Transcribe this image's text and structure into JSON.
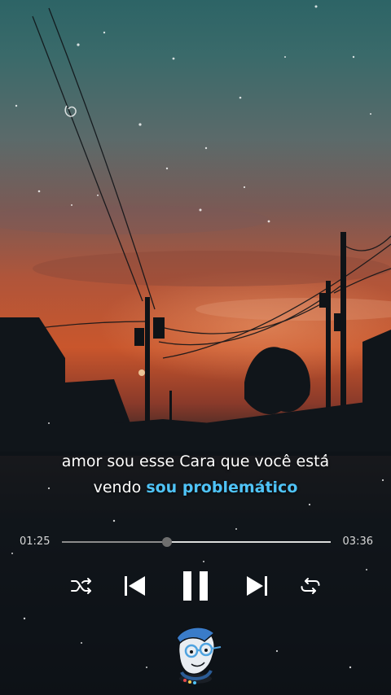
{
  "lyrics": {
    "line1": "amor sou esse Cara que você está",
    "line2_plain": "vendo ",
    "line2_highlight": "sou problemático"
  },
  "player": {
    "current_time": "01:25",
    "total_time": "03:36",
    "progress": 0.39
  },
  "controls": {
    "shuffle_icon": "shuffle-icon",
    "previous_icon": "skip-previous-icon",
    "play_pause_icon": "pause-icon",
    "next_icon": "skip-next-icon",
    "repeat_icon": "repeat-icon"
  },
  "colors": {
    "highlight": "#4fc3f7",
    "text": "#ffffff"
  }
}
